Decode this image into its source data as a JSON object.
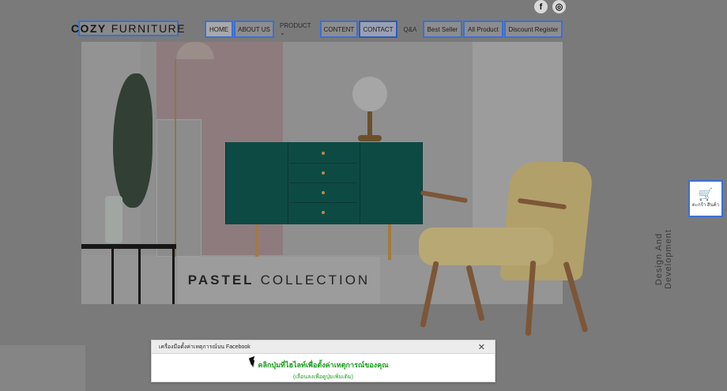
{
  "social": {
    "facebook_glyph": "f",
    "instagram_glyph": "◎",
    "facebook_icon": "facebook-icon",
    "instagram_icon": "instagram-icon"
  },
  "logo": {
    "part1": "COZY",
    "part2": "FURNITURE"
  },
  "nav": {
    "home": "HOME",
    "about": "ABOUT US",
    "product": "PRODUCT ⌄",
    "content": "CONTENT",
    "contact": "CONTACT",
    "qa": "Q&A",
    "best_seller": "Best Seller",
    "all_product": "All Product",
    "discount": "Discount Register"
  },
  "hero": {
    "caption_bold": "PASTEL",
    "caption_rest": "COLLECTION"
  },
  "side_text": "Design And Development",
  "cart": {
    "glyph": "🛒",
    "label": "ตะกร้า สินค้า",
    "icon": "cart-icon"
  },
  "popup": {
    "title": "เครื่องมือตั้งค่าเหตุการณ์บน Facebook",
    "close": "✕",
    "main": "คลิกปุ่มที่ไฮไลท์เพื่อตั้งค่าเหตุการณ์ของคุณ",
    "sub": "(เลื่อนลงเพื่อดูปุ่มเพิ่มเติม)"
  },
  "colors": {
    "accent": "#3b6fd6",
    "popup_text": "#1a9c1a",
    "cabinet": "#0e4a44"
  }
}
